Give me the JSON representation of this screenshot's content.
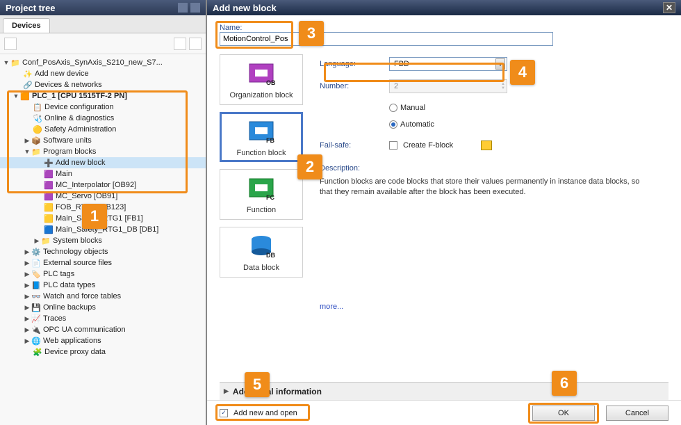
{
  "projtree": {
    "title": "Project tree",
    "tab": "Devices",
    "root": "Conf_PosAxis_SynAxis_S210_new_S7...",
    "add_device": "Add new device",
    "devices_networks": "Devices & networks",
    "plc": "PLC_1 [CPU 1515TF-2 PN]",
    "device_config": "Device configuration",
    "online_diag": "Online & diagnostics",
    "safety_admin": "Safety Administration",
    "software_units": "Software units",
    "program_blocks": "Program blocks",
    "add_block": "Add new block",
    "main": "Main",
    "mc_interp": "MC_Interpolator [OB92]",
    "mc_servo": "MC_Servo [OB91]",
    "fob": "FOB_RTG1 [OB123]",
    "main_safety": "Main_Safety_RTG1 [FB1]",
    "main_safety_db": "Main_Safety_RTG1_DB [DB1]",
    "system_blocks": "System blocks",
    "tech": "Technology objects",
    "ext_src": "External source files",
    "tags": "PLC tags",
    "datatypes": "PLC data types",
    "watch": "Watch and force tables",
    "backups": "Online backups",
    "traces": "Traces",
    "opcua": "OPC UA communication",
    "webapp": "Web applications",
    "proxy": "Device proxy data"
  },
  "dialog": {
    "title": "Add new block",
    "name_label": "Name:",
    "name_value": "MotionControl_Pos",
    "types": {
      "ob": "Organization block",
      "fb": "Function block",
      "fc": "Function",
      "db": "Data block"
    },
    "language_label": "Language:",
    "language_value": "FBD",
    "number_label": "Number:",
    "number_value": "2",
    "manual": "Manual",
    "automatic": "Automatic",
    "failsafe_label": "Fail-safe:",
    "create_fblock": "Create F-block",
    "desc_label": "Description:",
    "desc_text": "Function blocks are code blocks that store their values permanently in instance data blocks, so that they remain available after the block has been executed.",
    "more": "more...",
    "additional": "Additional information",
    "add_open": "Add new and open",
    "ok": "OK",
    "cancel": "Cancel"
  },
  "callouts": {
    "c1": "1",
    "c2": "2",
    "c3": "3",
    "c4": "4",
    "c5": "5",
    "c6": "6"
  }
}
